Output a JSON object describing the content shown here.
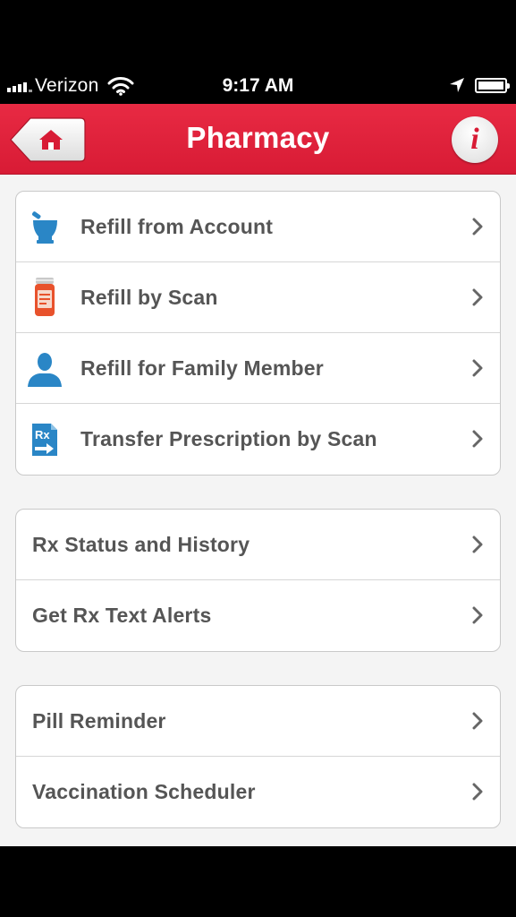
{
  "status_bar": {
    "carrier": "Verizon",
    "time": "9:17 AM",
    "icons": [
      "signal-bars-icon",
      "wifi-icon",
      "location-arrow-icon",
      "battery-icon"
    ]
  },
  "nav": {
    "title": "Pharmacy",
    "home_icon": "home-icon",
    "info_glyph": "i"
  },
  "groups": [
    {
      "items": [
        {
          "label": "Refill from Account",
          "icon": "mortar-pestle-icon"
        },
        {
          "label": "Refill by Scan",
          "icon": "pill-bottle-icon"
        },
        {
          "label": "Refill for Family Member",
          "icon": "person-icon"
        },
        {
          "label": "Transfer Prescription by Scan",
          "icon": "rx-transfer-icon"
        }
      ]
    },
    {
      "items": [
        {
          "label": "Rx Status and History"
        },
        {
          "label": "Get Rx Text Alerts"
        }
      ]
    },
    {
      "items": [
        {
          "label": "Pill Reminder"
        },
        {
          "label": "Vaccination Scheduler"
        }
      ]
    }
  ],
  "colors": {
    "nav_red": "#d81b35",
    "icon_blue": "#2a86c6",
    "bottle_orange": "#e8522c",
    "label_gray": "#555555"
  }
}
